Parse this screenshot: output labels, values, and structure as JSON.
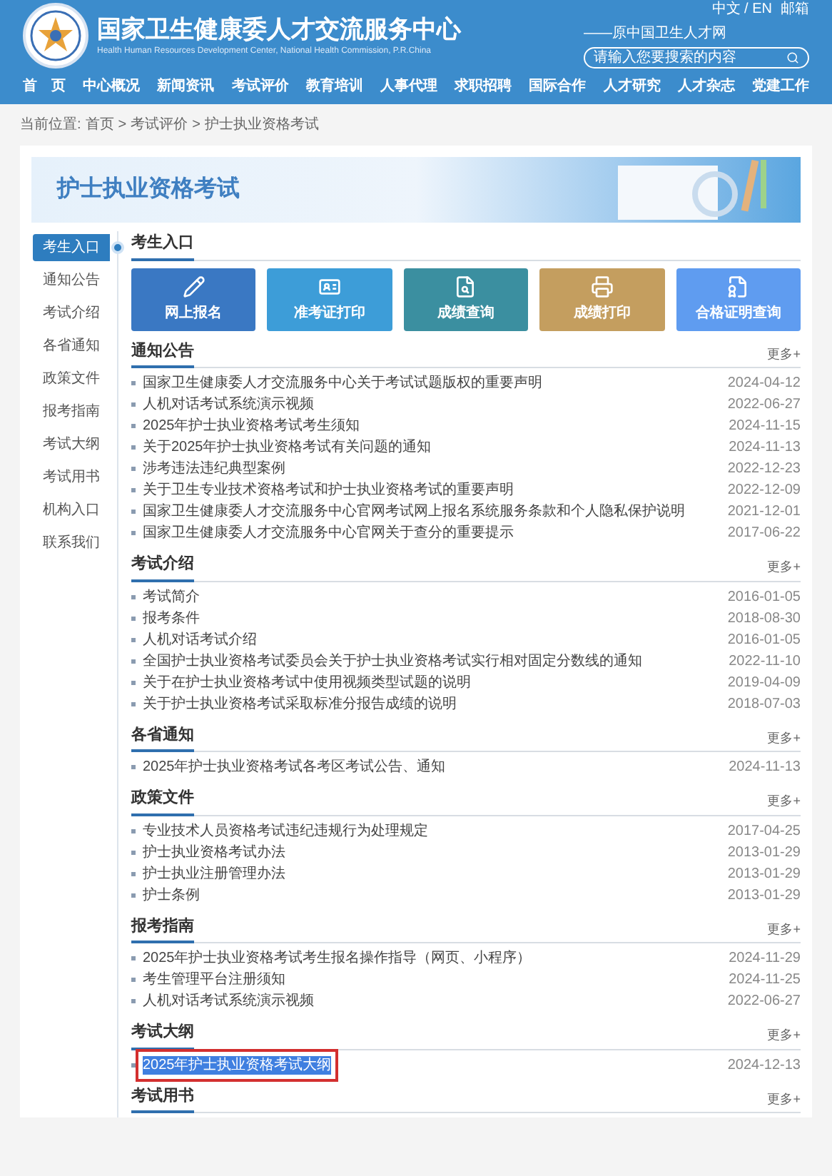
{
  "header": {
    "title": "国家卫生健康委人才交流服务中心",
    "subtitle": "Health Human Resources Development Center, National Health Commission, P.R.China",
    "former_name": "——原中国卫生人才网",
    "lang": "中文 / EN",
    "mail": "邮箱",
    "search": {
      "placeholder": "请输入您要搜索的内容"
    }
  },
  "nav": [
    {
      "label": "首　页"
    },
    {
      "label": "中心概况"
    },
    {
      "label": "新闻资讯"
    },
    {
      "label": "考试评价"
    },
    {
      "label": "教育培训"
    },
    {
      "label": "人事代理"
    },
    {
      "label": "求职招聘"
    },
    {
      "label": "国际合作"
    },
    {
      "label": "人才研究"
    },
    {
      "label": "人才杂志"
    },
    {
      "label": "党建工作"
    }
  ],
  "breadcrumb": {
    "prefix": "当前位置:",
    "items": [
      "首页",
      "考试评价",
      "护士执业资格考试"
    ],
    "separator": ">"
  },
  "banner": {
    "title": "护士执业资格考试"
  },
  "sidebar": [
    {
      "label": "考生入口",
      "selected": true
    },
    {
      "label": "通知公告",
      "selected": false
    },
    {
      "label": "考试介绍",
      "selected": false
    },
    {
      "label": "各省通知",
      "selected": false
    },
    {
      "label": "政策文件",
      "selected": false
    },
    {
      "label": "报考指南",
      "selected": false
    },
    {
      "label": "考试大纲",
      "selected": false
    },
    {
      "label": "考试用书",
      "selected": false
    },
    {
      "label": "机构入口",
      "selected": false
    },
    {
      "label": "联系我们",
      "selected": false
    }
  ],
  "entry": {
    "title": "考生入口",
    "tiles": [
      {
        "label": "网上报名",
        "kind": "pencil",
        "color": "#3a78c3"
      },
      {
        "label": "准考证打印",
        "kind": "card",
        "color": "#3d9dd8"
      },
      {
        "label": "成绩查询",
        "kind": "search",
        "color": "#3b8fa0"
      },
      {
        "label": "成绩打印",
        "kind": "print",
        "color": "#c49e5f"
      },
      {
        "label": "合格证明查询",
        "kind": "cert",
        "color": "#5f9cf0"
      }
    ]
  },
  "sections": [
    {
      "title": "通知公告",
      "more": "更多+",
      "items": [
        {
          "title": "国家卫生健康委人才交流服务中心关于考试试题版权的重要声明",
          "date": "2024-04-12",
          "highlighted": false
        },
        {
          "title": "人机对话考试系统演示视频",
          "date": "2022-06-27",
          "highlighted": false
        },
        {
          "title": "2025年护士执业资格考试考生须知",
          "date": "2024-11-15",
          "highlighted": false
        },
        {
          "title": "关于2025年护士执业资格考试有关问题的通知",
          "date": "2024-11-13",
          "highlighted": false
        },
        {
          "title": "涉考违法违纪典型案例",
          "date": "2022-12-23",
          "highlighted": false
        },
        {
          "title": "关于卫生专业技术资格考试和护士执业资格考试的重要声明",
          "date": "2022-12-09",
          "highlighted": false
        },
        {
          "title": "国家卫生健康委人才交流服务中心官网考试网上报名系统服务条款和个人隐私保护说明",
          "date": "2021-12-01",
          "highlighted": false
        },
        {
          "title": "国家卫生健康委人才交流服务中心官网关于查分的重要提示",
          "date": "2017-06-22",
          "highlighted": false
        }
      ]
    },
    {
      "title": "考试介绍",
      "more": "更多+",
      "items": [
        {
          "title": "考试简介",
          "date": "2016-01-05",
          "highlighted": false
        },
        {
          "title": "报考条件",
          "date": "2018-08-30",
          "highlighted": false
        },
        {
          "title": "人机对话考试介绍",
          "date": "2016-01-05",
          "highlighted": false
        },
        {
          "title": "全国护士执业资格考试委员会关于护士执业资格考试实行相对固定分数线的通知",
          "date": "2022-11-10",
          "highlighted": false
        },
        {
          "title": "关于在护士执业资格考试中使用视频类型试题的说明",
          "date": "2019-04-09",
          "highlighted": false
        },
        {
          "title": "关于护士执业资格考试采取标准分报告成绩的说明",
          "date": "2018-07-03",
          "highlighted": false
        }
      ]
    },
    {
      "title": "各省通知",
      "more": "更多+",
      "items": [
        {
          "title": "2025年护士执业资格考试各考区考试公告、通知",
          "date": "2024-11-13",
          "highlighted": false
        }
      ]
    },
    {
      "title": "政策文件",
      "more": "更多+",
      "items": [
        {
          "title": "专业技术人员资格考试违纪违规行为处理规定",
          "date": "2017-04-25",
          "highlighted": false
        },
        {
          "title": "护士执业资格考试办法",
          "date": "2013-01-29",
          "highlighted": false
        },
        {
          "title": "护士执业注册管理办法",
          "date": "2013-01-29",
          "highlighted": false
        },
        {
          "title": "护士条例",
          "date": "2013-01-29",
          "highlighted": false
        }
      ]
    },
    {
      "title": "报考指南",
      "more": "更多+",
      "items": [
        {
          "title": "2025年护士执业资格考试考生报名操作指导（网页、小程序）",
          "date": "2024-11-29",
          "highlighted": false
        },
        {
          "title": "考生管理平台注册须知",
          "date": "2024-11-25",
          "highlighted": false
        },
        {
          "title": "人机对话考试系统演示视频",
          "date": "2022-06-27",
          "highlighted": false
        }
      ]
    },
    {
      "title": "考试大纲",
      "more": "更多+",
      "items": [
        {
          "title": "2025年护士执业资格考试大纲",
          "date": "2024-12-13",
          "highlighted": true
        }
      ]
    },
    {
      "title": "考试用书",
      "more": "更多+"
    }
  ]
}
